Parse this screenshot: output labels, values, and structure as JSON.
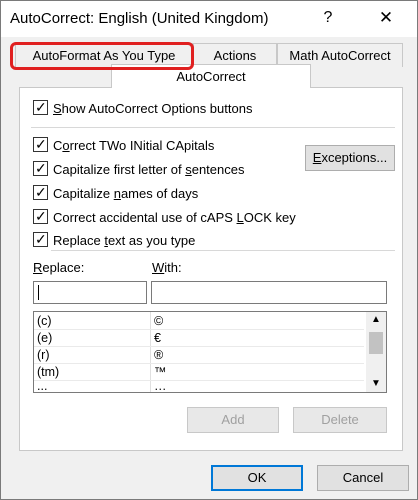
{
  "window": {
    "title": "AutoCorrect: English (United Kingdom)",
    "help_glyph": "?",
    "close_glyph": "✕"
  },
  "tabs": {
    "row_back": [
      {
        "label": "AutoFormat As You Type"
      },
      {
        "label": "Actions"
      },
      {
        "label": "Math AutoCorrect"
      }
    ],
    "active": {
      "label": "AutoCorrect"
    }
  },
  "highlight": {
    "color": "#e02020",
    "target": "AutoFormat As You Type"
  },
  "options": {
    "show_buttons": {
      "label_pre": "",
      "label_u": "S",
      "label_post": "how AutoCorrect Options buttons",
      "checked": true
    },
    "correct_two_initial": {
      "label_pre": "C",
      "label_u": "o",
      "label_post": "rrect TWo INitial CApitals",
      "checked": true
    },
    "capitalize_first_letter": {
      "label_pre": "Capitalize first letter of ",
      "label_u": "s",
      "label_post": "entences",
      "checked": true
    },
    "capitalize_days": {
      "label_pre": "Capitalize ",
      "label_u": "n",
      "label_post": "ames of days",
      "checked": true
    },
    "correct_caps_lock": {
      "label_pre": "Correct accidental use of cAPS ",
      "label_u": "L",
      "label_post": "OCK key",
      "checked": true
    },
    "replace_text": {
      "label_pre": "Replace ",
      "label_u": "t",
      "label_post": "ext as you type",
      "checked": true
    }
  },
  "buttons": {
    "exceptions_pre": "",
    "exceptions_u": "E",
    "exceptions_post": "xceptions...",
    "add": "Add",
    "delete": "Delete",
    "ok": "OK",
    "cancel": "Cancel"
  },
  "replace_section": {
    "replace_label_u": "R",
    "replace_label_post": "eplace:",
    "with_label_u": "W",
    "with_label_post": "ith:",
    "replace_value": "",
    "with_value": ""
  },
  "list": {
    "rows": [
      {
        "replace": "(c)",
        "with": "©"
      },
      {
        "replace": "(e)",
        "with": "€"
      },
      {
        "replace": "(r)",
        "with": "®"
      },
      {
        "replace": "(tm)",
        "with": "™"
      },
      {
        "replace": "...",
        "with": "…"
      }
    ]
  }
}
